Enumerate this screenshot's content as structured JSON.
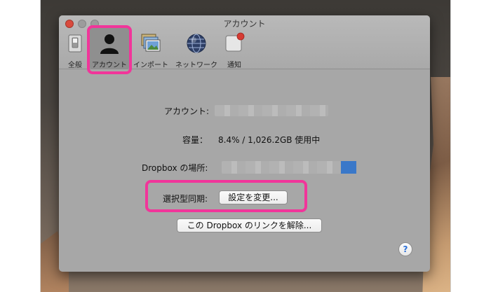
{
  "window": {
    "title": "アカウント"
  },
  "toolbar": {
    "items": [
      {
        "label": "全般",
        "icon": "switch-icon"
      },
      {
        "label": "アカウント",
        "icon": "person-icon",
        "selected": true
      },
      {
        "label": "インポート",
        "icon": "photos-icon"
      },
      {
        "label": "ネットワーク",
        "icon": "globe-icon"
      },
      {
        "label": "通知",
        "icon": "notification-icon",
        "badge_color": "#d63b33"
      }
    ]
  },
  "account": {
    "account_label": "アカウント:",
    "capacity_label": "容量：",
    "capacity_value": "8.4% / 1,026.2GB 使用中",
    "location_label": "Dropbox の場所:",
    "selective_sync_label": "選択型同期:",
    "change_settings_button": "設定を変更...",
    "unlink_button": "この Dropbox のリンクを解除..."
  },
  "help": {
    "label": "?"
  },
  "colors": {
    "highlight": "#f1359a",
    "close_button": "#d94a3d",
    "window_bg": "#a7a7a7",
    "folder_blue": "#3a78c9"
  }
}
